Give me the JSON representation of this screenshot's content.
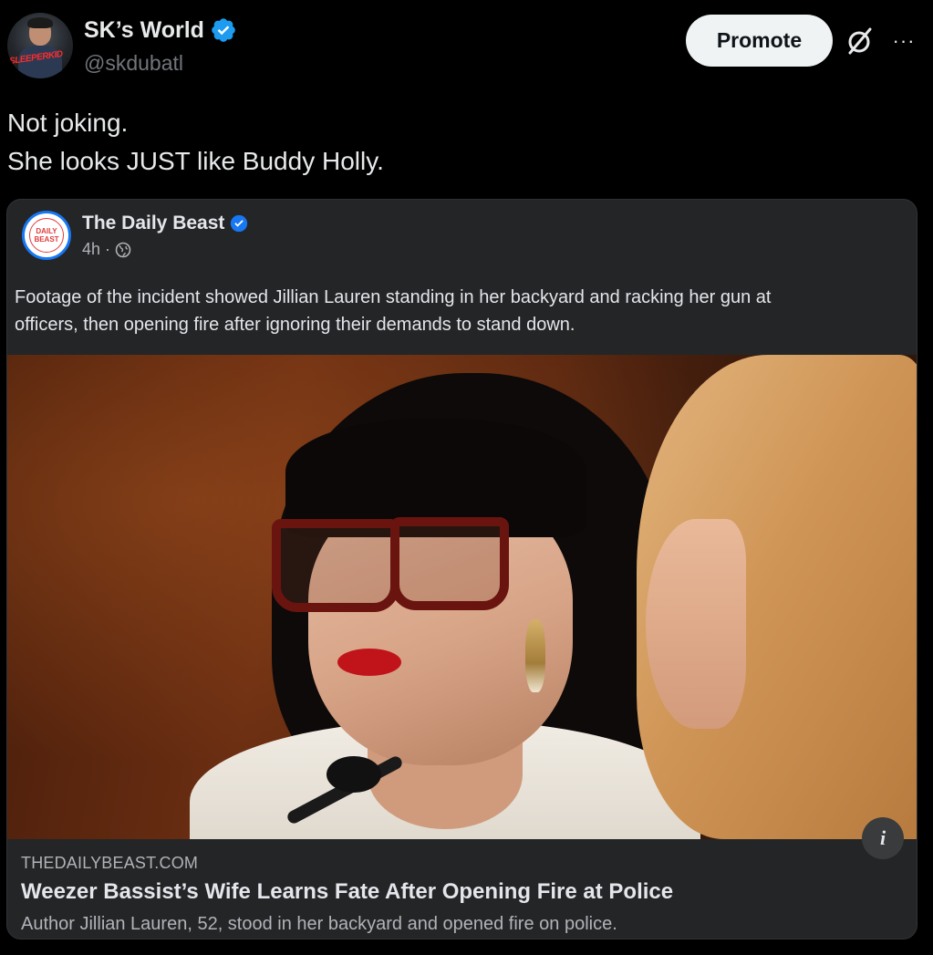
{
  "tweet": {
    "author_name": "SK’s World",
    "author_handle": "@skdubatl",
    "avatar_text": "SLEEPERKID",
    "promote_label": "Promote",
    "more_label": "···",
    "text_lines": [
      "Not joking.",
      "She looks JUST like Buddy Holly."
    ]
  },
  "card": {
    "page_name": "The Daily Beast",
    "logo_text": [
      "DAILY",
      "BEAST"
    ],
    "time": "4h",
    "separator": "·",
    "post_lines": [
      "Footage of the incident showed Jillian Lauren standing in her backyard and racking her gun at",
      "officers, then opening fire after ignoring their demands to stand down."
    ],
    "info_label": "i",
    "link_domain": "THEDAILYBEAST.COM",
    "link_title": "Weezer Bassist’s Wife Learns Fate After Opening Fire at Police",
    "link_desc": "Author Jillian Lauren, 52, stood in her backyard and opened fire on police."
  },
  "icons": {
    "verified": "verified-badge-icon",
    "grok": "grok-icon",
    "more": "more-icon",
    "globe": "globe-icon",
    "info": "info-icon"
  },
  "colors": {
    "background": "#000000",
    "card_background": "#242526",
    "verified_blue": "#1d9bf0",
    "fb_blue": "#1877f2",
    "secondary_text": "#71767b",
    "primary_text": "#e7e9ea"
  }
}
